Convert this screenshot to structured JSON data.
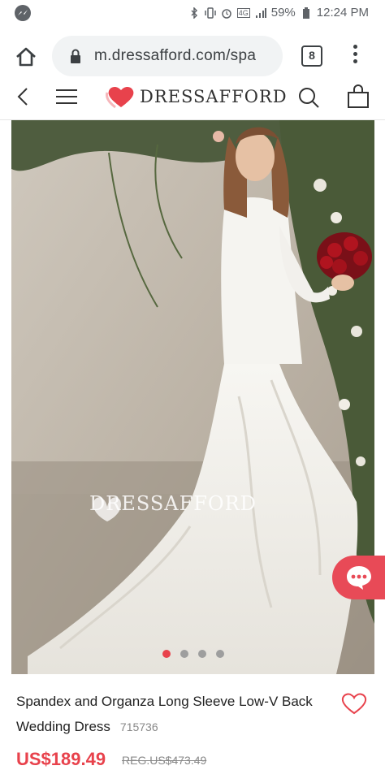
{
  "status_bar": {
    "battery": "59%",
    "time": "12:24 PM",
    "network": "4G"
  },
  "browser": {
    "url": "m.dressafford.com/spa",
    "tab_count": "8"
  },
  "site": {
    "brand": "DRESSAFFORD",
    "brand_color": "#e8424c"
  },
  "gallery": {
    "watermark": "DRESSAFFORD",
    "slide_count": 4,
    "active_slide": 1
  },
  "product": {
    "title": "Spandex and Organza Long Sleeve Low-V Back Wedding Dress",
    "sku": "715736",
    "price": "US$189.49",
    "reg_price": "REG.US$473.49"
  },
  "icons": {
    "status": [
      "messenger-icon",
      "bluetooth-icon",
      "vibrate-icon",
      "alarm-icon",
      "signal-icon",
      "battery-icon"
    ],
    "browser": [
      "home-icon",
      "lock-icon",
      "tabs-icon",
      "more-vert-icon"
    ],
    "site": [
      "back-icon",
      "hamburger-icon",
      "search-icon",
      "bag-icon",
      "chat-icon",
      "heart-icon"
    ]
  }
}
